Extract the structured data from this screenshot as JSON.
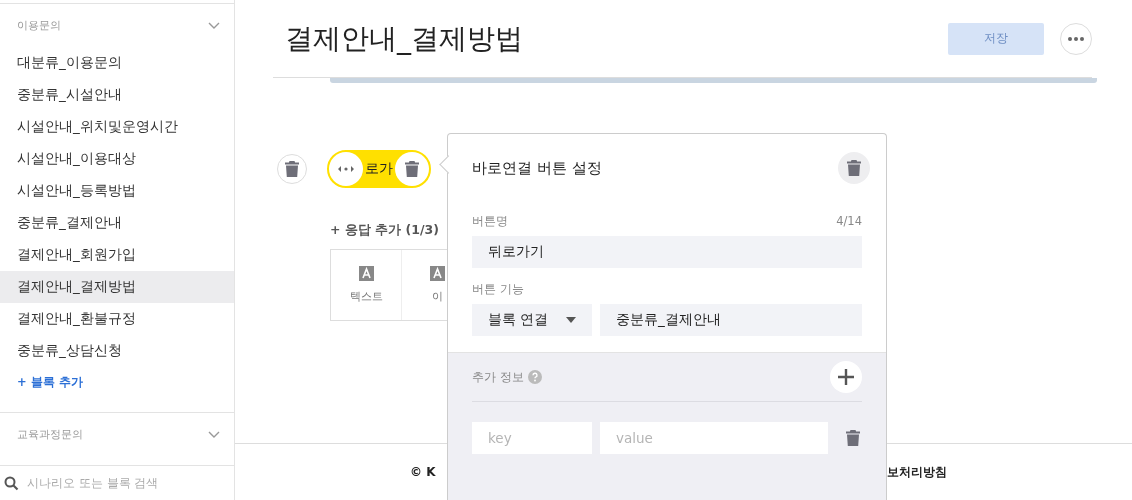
{
  "sidebar": {
    "groups": [
      {
        "title": "이용문의",
        "items": [
          {
            "label": "대분류_이용문의",
            "selected": false
          },
          {
            "label": "중분류_시설안내",
            "selected": false
          },
          {
            "label": "시설안내_위치및운영시간",
            "selected": false
          },
          {
            "label": "시설안내_이용대상",
            "selected": false
          },
          {
            "label": "시설안내_등록방법",
            "selected": false
          },
          {
            "label": "중분류_결제안내",
            "selected": false
          },
          {
            "label": "결제안내_회원가입",
            "selected": false
          },
          {
            "label": "결제안내_결제방법",
            "selected": true
          },
          {
            "label": "결제안내_환불규정",
            "selected": false
          },
          {
            "label": "중분류_상담신청",
            "selected": false
          }
        ],
        "add_link": "+ 블록 추가"
      },
      {
        "title": "교육과정문의"
      }
    ],
    "search": {
      "placeholder": "시나리오 또는 블록 검색"
    }
  },
  "header": {
    "title": "결제안내_결제방법",
    "save_button": {
      "label": "저장",
      "disabled": true
    }
  },
  "quick_reply": {
    "label": "로가"
  },
  "add_response": {
    "label": "+ 응답 추가 (1/3)",
    "options": [
      {
        "label": "텍스트"
      },
      {
        "label": "이"
      }
    ]
  },
  "popover": {
    "title": "바로연결 버튼 설정",
    "name_label": "버튼명",
    "name_count": "4/14",
    "name_value": "뒤로가기",
    "function_label": "버튼 기능",
    "function_select": "블록 연결",
    "function_target": "중분류_결제안내",
    "extra_label": "추가 정보",
    "key_placeholder": "key",
    "value_placeholder": "value"
  },
  "footer": {
    "left": "© K",
    "right": "보처리방침"
  }
}
